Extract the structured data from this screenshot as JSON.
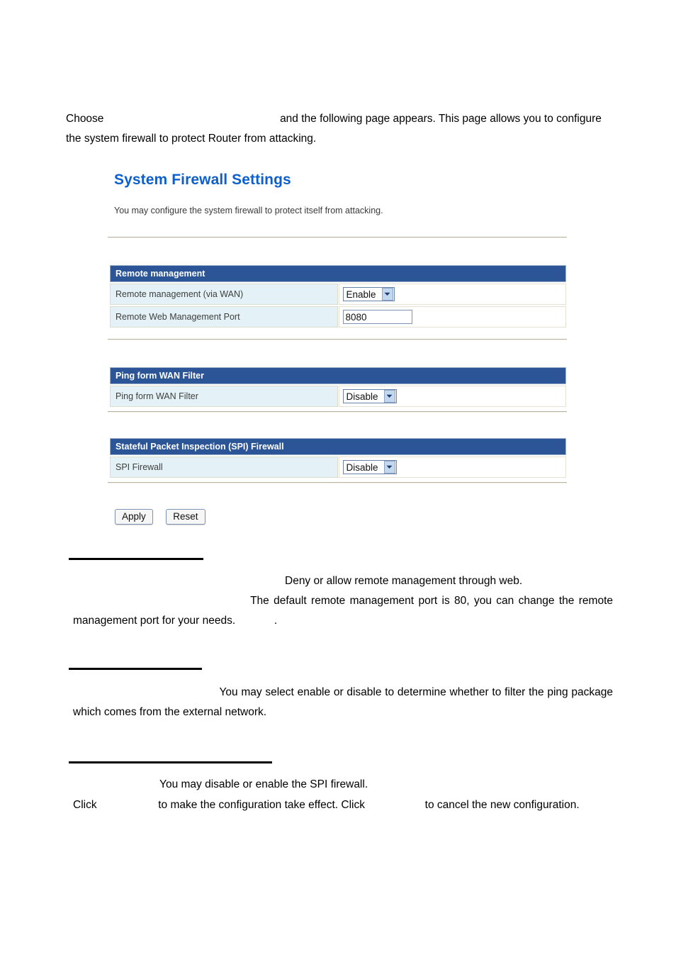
{
  "document": {
    "intro": {
      "lead": "Choose",
      "after_gap": "and the following page appears. This page allows you to configure the system firewall to protect Router from attacking."
    },
    "sections": [
      {
        "name": "remote-management-description",
        "lines": [
          "Deny or allow remote management through web.",
          "The default remote management port is 80, you can change the remote management port for your needs.",
          "."
        ]
      },
      {
        "name": "ping-from-wan-description",
        "lines": [
          "You may select enable or disable to determine whether to filter the ping package which comes from the external network."
        ]
      },
      {
        "name": "spi-firewall-description",
        "lines": [
          "You may disable or enable the SPI firewall.",
          "Click",
          "to make the configuration take effect. Click",
          "to cancel the new configuration."
        ]
      }
    ]
  },
  "screenshot": {
    "title": "System Firewall Settings",
    "subtitle": "You may configure the system firewall to protect itself from attacking.",
    "accent_color": "#0b5fd0",
    "header_color": "#2b5597",
    "label_cell_color": "#e4f2f7",
    "sections": [
      {
        "header": "Remote management",
        "rows": [
          {
            "label": "Remote management (via WAN)",
            "control": "select",
            "value": "Enable",
            "options": [
              "Enable",
              "Disable"
            ]
          },
          {
            "label": "Remote Web Management Port",
            "control": "text",
            "value": "8080",
            "placeholder": ""
          }
        ]
      },
      {
        "header": "Ping form WAN Filter",
        "rows": [
          {
            "label": "Ping form WAN Filter",
            "control": "select",
            "value": "Disable",
            "options": [
              "Enable",
              "Disable"
            ]
          }
        ]
      },
      {
        "header": "Stateful Packet Inspection (SPI) Firewall",
        "rows": [
          {
            "label": "SPI Firewall",
            "control": "select",
            "value": "Disable",
            "options": [
              "Enable",
              "Disable"
            ]
          }
        ]
      }
    ],
    "buttons": {
      "apply_label": "Apply",
      "reset_label": "Reset"
    }
  }
}
